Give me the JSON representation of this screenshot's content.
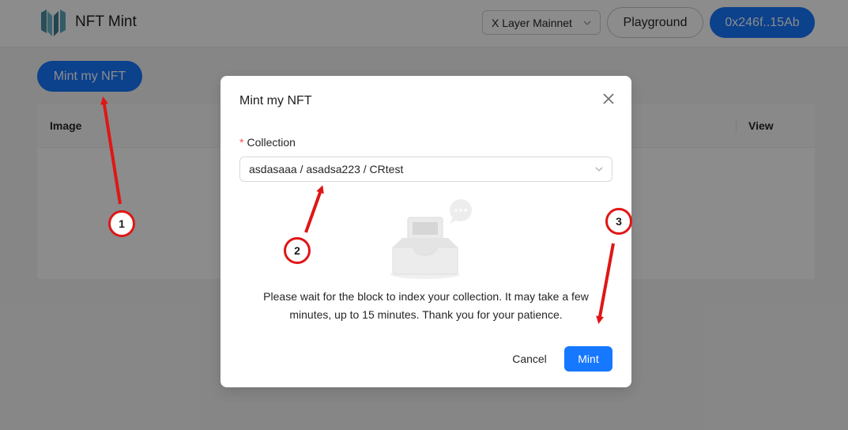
{
  "header": {
    "app_title": "NFT Mint",
    "network": "X Layer Mainnet",
    "playground_label": "Playground",
    "wallet_label": "0x246f..15Ab",
    "icons": {
      "logo": "nft-mint-logo",
      "network_chevron": "chevron-down-icon"
    }
  },
  "page": {
    "mint_button_label": "Mint my NFT",
    "table": {
      "columns": [
        "Image",
        "View"
      ]
    }
  },
  "modal": {
    "title": "Mint my NFT",
    "field_label": "Collection",
    "required_mark": "*",
    "collection_value": "asdasaaa / asadsa223 / CRtest",
    "notice_text": "Please wait for the block to index your collection. It may take a few minutes, up to 15 minutes. Thank you for your patience.",
    "cancel_label": "Cancel",
    "mint_label": "Mint",
    "icons": {
      "close": "close-icon",
      "chevron": "chevron-down-icon",
      "illustration": "empty-inbox-illustration"
    }
  },
  "annotations": {
    "steps": [
      "1",
      "2",
      "3"
    ],
    "color": "#e01616"
  },
  "colors": {
    "primary": "#1677ff",
    "required": "#ff4d4f",
    "annotation": "#e01616"
  }
}
